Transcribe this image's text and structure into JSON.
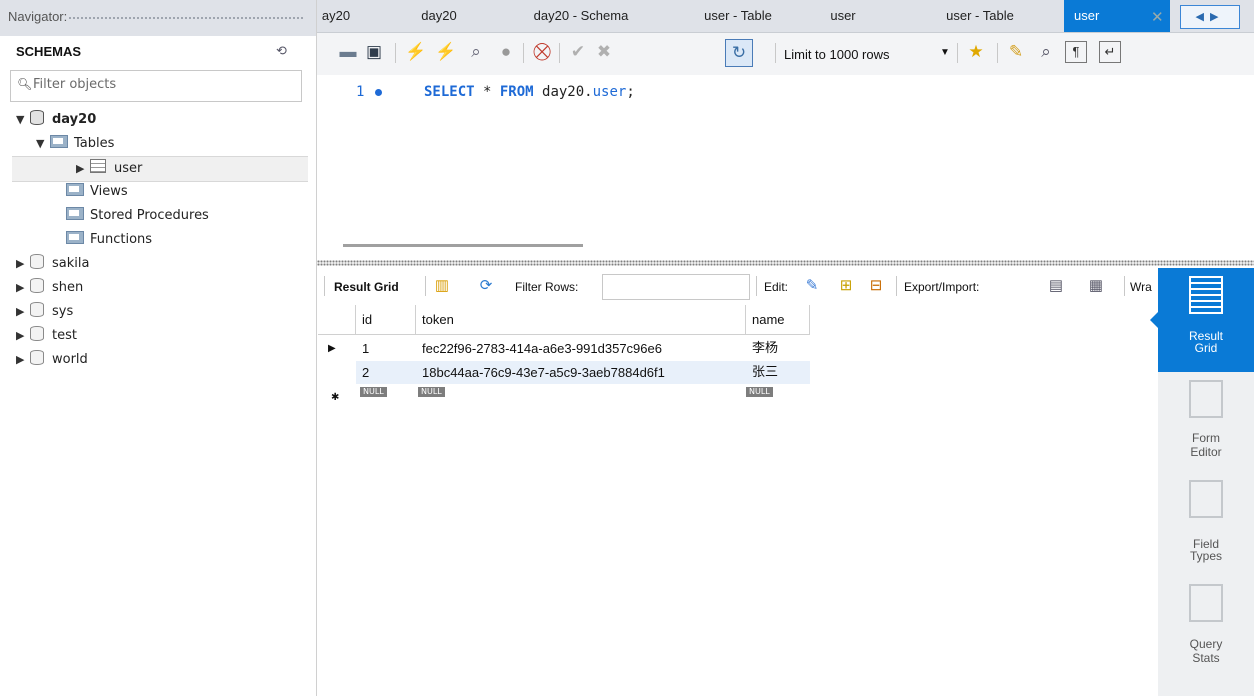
{
  "navigator": {
    "title": "Navigator:",
    "schemas_label": "SCHEMAS",
    "filter_placeholder": "Filter objects",
    "tree": {
      "day20": "day20",
      "tables": "Tables",
      "user": "user",
      "views": "Views",
      "stored_procedures": "Stored Procedures",
      "functions": "Functions",
      "sakila": "sakila",
      "shen": "shen",
      "sys": "sys",
      "test": "test",
      "world": "world"
    }
  },
  "tabs": [
    "ay20",
    "day20",
    "day20 - Schema",
    "user - Table",
    "user",
    "user - Table",
    "user"
  ],
  "toolbar": {
    "limit_label": "Limit to 1000 rows"
  },
  "editor": {
    "line_number": "1",
    "sql": {
      "kw1": "SELECT",
      "star": " * ",
      "kw2": "FROM",
      "table": " day20.",
      "col": "user",
      "semi": ";"
    }
  },
  "result_toolbar": {
    "result_grid": "Result Grid",
    "filter_rows": "Filter Rows:",
    "edit": "Edit:",
    "export_import": "Export/Import:",
    "wrap": "Wra"
  },
  "grid": {
    "columns": [
      "id",
      "token",
      "name"
    ],
    "rows": [
      [
        "1",
        "fec22f96-2783-414a-a6e3-991d357c96e6",
        "李杨"
      ],
      [
        "2",
        "18bc44aa-76c9-43e7-a5c9-3aeb7884d6f1",
        "张三"
      ]
    ],
    "null_label": "NULL",
    "new_row_marker": "✱"
  },
  "side_panel": {
    "result_grid": [
      "Result",
      "Grid"
    ],
    "form_editor": [
      "Form",
      "Editor"
    ],
    "field_types": [
      "Field",
      "Types"
    ],
    "query_stats": [
      "Query",
      "Stats"
    ]
  }
}
